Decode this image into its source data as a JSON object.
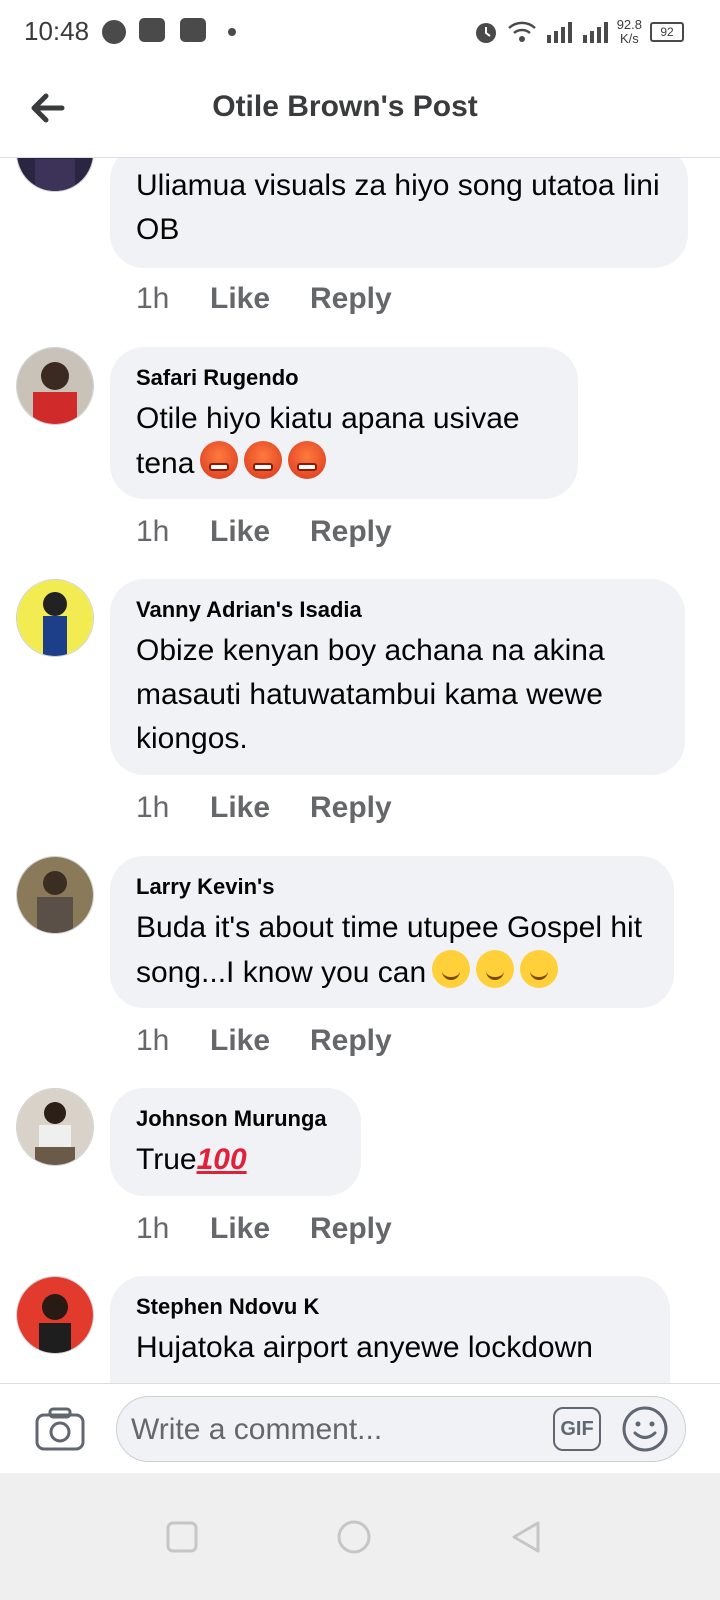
{
  "status_bar": {
    "time": "10:48",
    "network_speed_value": "92.8",
    "network_speed_unit": "K/s",
    "battery": "92"
  },
  "header": {
    "title": "Otile Brown's Post",
    "back_icon": "arrow-left-icon"
  },
  "comments": [
    {
      "author": "",
      "text": "Uliamua visuals za hiyo song utatoa lini OB",
      "time": "1h",
      "like": "Like",
      "reply": "Reply"
    },
    {
      "author": "Safari Rugendo",
      "text": "Otile hiyo kiatu apana usivae tena",
      "emoji": "angry",
      "emoji_count": 3,
      "time": "1h",
      "like": "Like",
      "reply": "Reply"
    },
    {
      "author": "Vanny Adrian's Isadia",
      "text": "Obize kenyan boy achana na akina masauti hatuwatambui kama wewe kiongos.",
      "time": "1h",
      "like": "Like",
      "reply": "Reply"
    },
    {
      "author": "Larry Kevin's",
      "text": "Buda it's about time utupee Gospel hit song...I know you can",
      "emoji": "smile",
      "emoji_count": 3,
      "time": "1h",
      "like": "Like",
      "reply": "Reply"
    },
    {
      "author": "Johnson Murunga",
      "text": "True",
      "emoji_text": "100",
      "time": "1h",
      "like": "Like",
      "reply": "Reply"
    },
    {
      "author": "Stephen Ndovu K",
      "text": "Hujatoka airport anyewe lockdown"
    }
  ],
  "composer": {
    "placeholder": "Write a comment...",
    "gif_label": "GIF",
    "camera_icon": "camera-icon",
    "emoji_icon": "smiley-icon"
  },
  "nav_bar": {
    "buttons": [
      "recent-apps-icon",
      "home-icon",
      "back-triangle-icon"
    ]
  },
  "colors": {
    "bubble": "#f0f2f5",
    "secondary_text": "#65676b",
    "header_title": "#3a3b3c"
  }
}
